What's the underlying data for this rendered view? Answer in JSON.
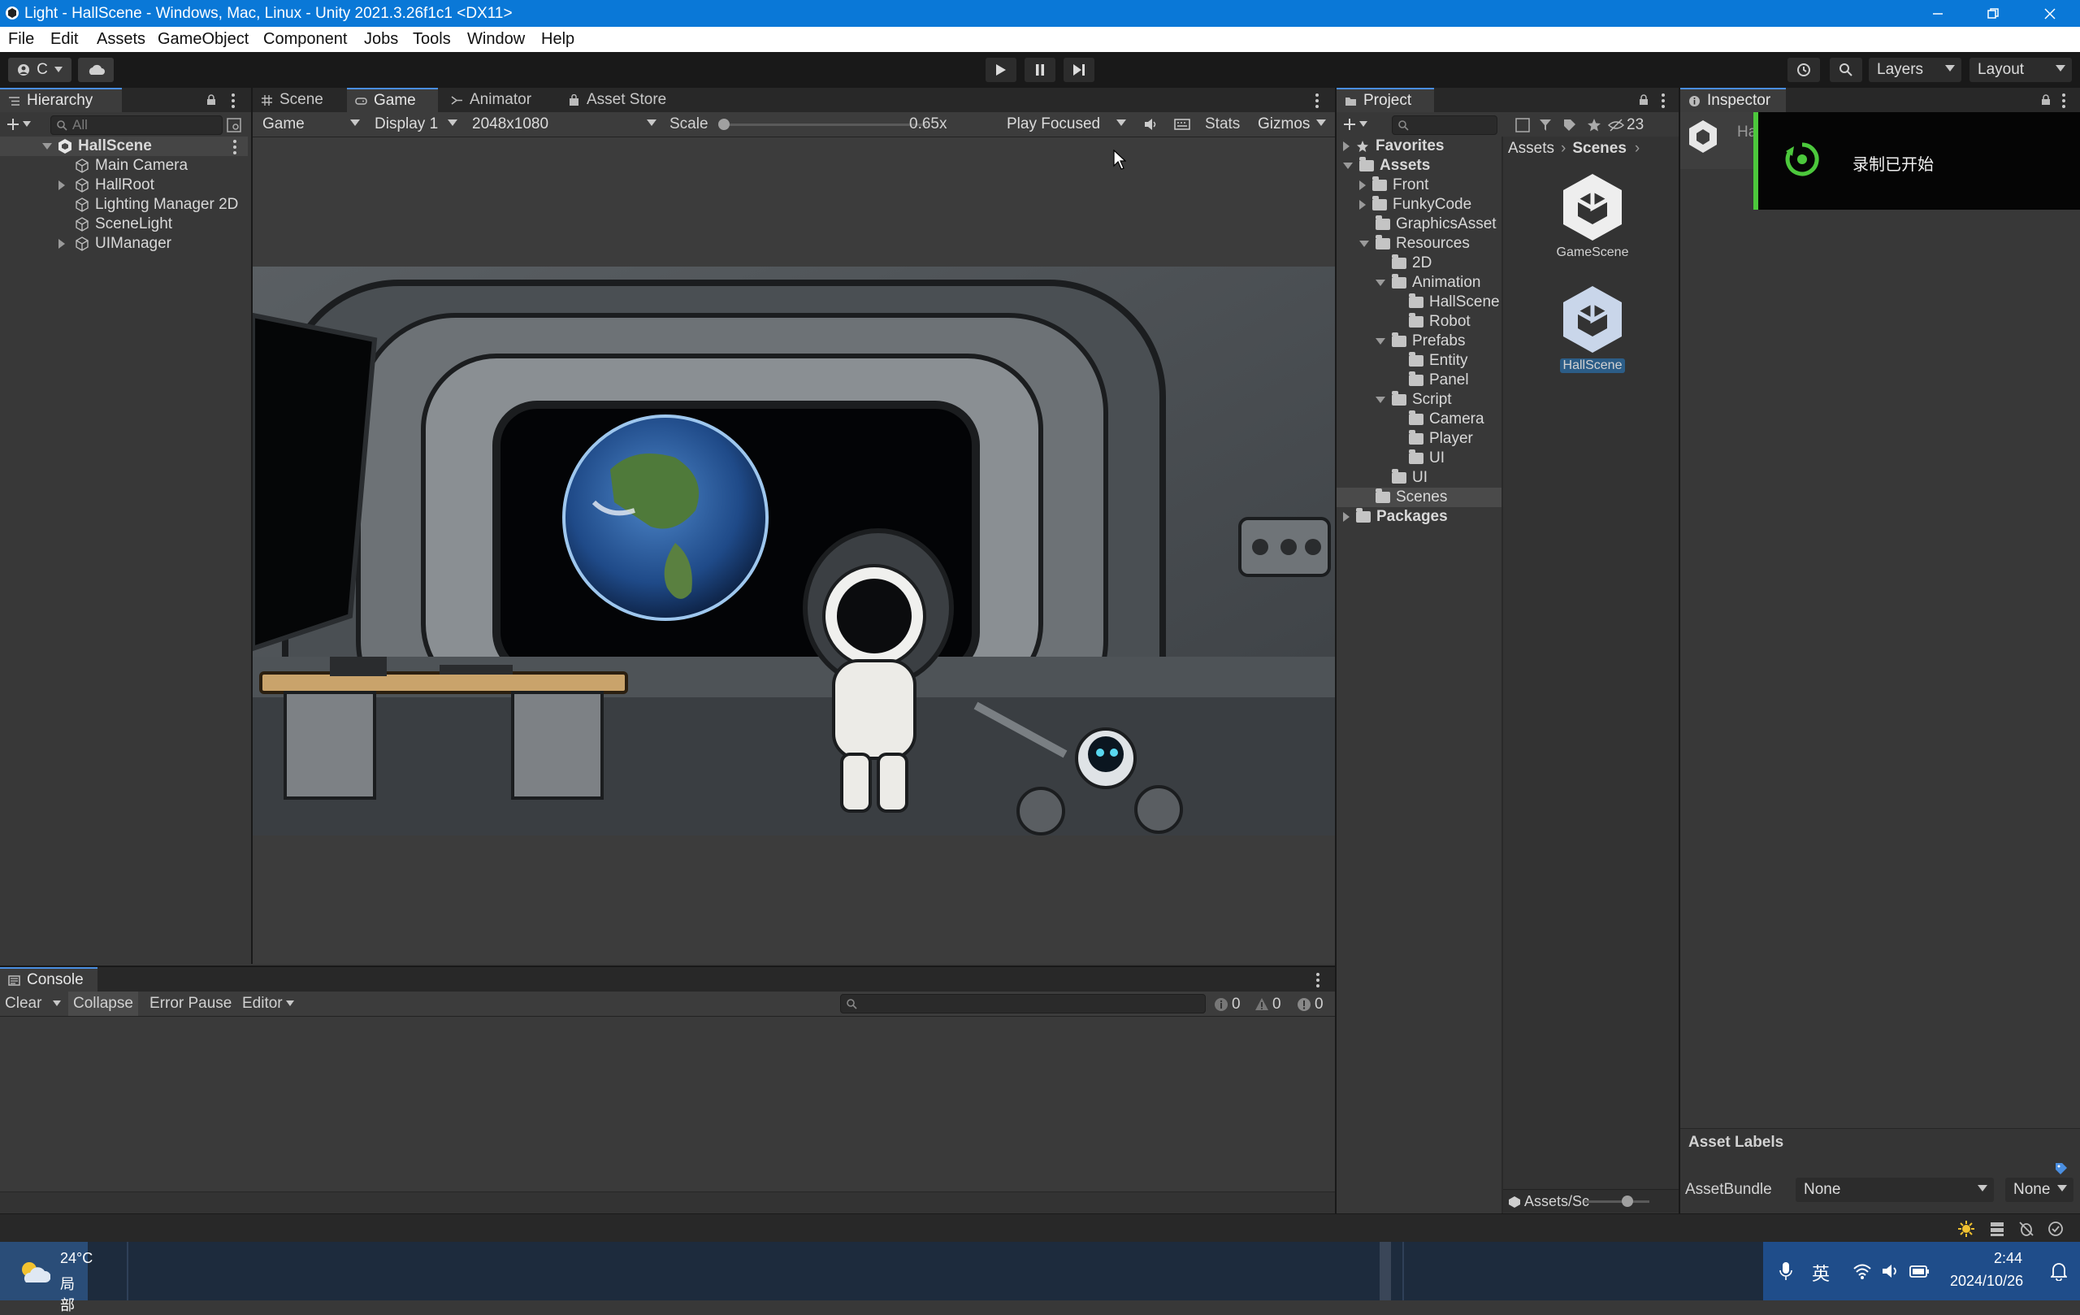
{
  "window": {
    "title": "Light - HallScene - Windows, Mac, Linux - Unity 2021.3.26f1c1 <DX11>"
  },
  "menu": [
    "File",
    "Edit",
    "Assets",
    "GameObject",
    "Component",
    "Jobs",
    "Tools",
    "Window",
    "Help"
  ],
  "toolbar": {
    "account_label": "C",
    "layers_label": "Layers",
    "layout_label": "Layout"
  },
  "hierarchy": {
    "tab": "Hierarchy",
    "search_placeholder": "All",
    "scene": "HallScene",
    "items": [
      "Main Camera",
      "HallRoot",
      "Lighting Manager 2D",
      "SceneLight",
      "UIManager"
    ]
  },
  "game_view": {
    "tabs": [
      "Scene",
      "Game",
      "Animator",
      "Asset Store"
    ],
    "mode": "Game",
    "display": "Display 1",
    "resolution": "2048x1080",
    "scale_label": "Scale",
    "scale_value": "0.65x",
    "play_mode": "Play Focused",
    "stats": "Stats",
    "gizmos": "Gizmos"
  },
  "project": {
    "tab": "Project",
    "hidden_count": "23",
    "favorites": "Favorites",
    "breadcrumb": [
      "Assets",
      "Scenes"
    ],
    "tree": {
      "assets": "Assets",
      "front": "Front",
      "funkycode": "FunkyCode",
      "graphicsasset": "GraphicsAsset",
      "resources": "Resources",
      "res_2d": "2D",
      "animation": "Animation",
      "anim_hallscene": "HallScene",
      "anim_robot": "Robot",
      "prefabs": "Prefabs",
      "prefab_entity": "Entity",
      "prefab_panel": "Panel",
      "script": "Script",
      "script_camera": "Camera",
      "script_player": "Player",
      "script_ui": "UI",
      "ui": "UI",
      "scenes": "Scenes",
      "packages": "Packages"
    },
    "files": [
      "GameScene",
      "HallScene"
    ],
    "footer_path": "Assets/Sc"
  },
  "inspector": {
    "tab": "Inspector",
    "header_name": "Ha",
    "recording_notice": "录制已开始",
    "asset_labels": "Asset Labels",
    "assetbundle_label": "AssetBundle",
    "assetbundle_value": "None",
    "variant_value": "None"
  },
  "console": {
    "tab": "Console",
    "clear": "Clear",
    "collapse": "Collapse",
    "error_pause": "Error Pause",
    "editor": "Editor",
    "info_count": "0",
    "warn_count": "0",
    "error_count": "0"
  },
  "taskbar": {
    "weather_temp": "24°C",
    "weather_text": "局部",
    "ime": "英",
    "time": "2:44",
    "date": "2024/10/26"
  },
  "colors": {
    "titlebar": "#0a78d7",
    "selection": "#2c5d87",
    "accent_tab": "#4a8ee0",
    "recording": "#4cc83c"
  }
}
